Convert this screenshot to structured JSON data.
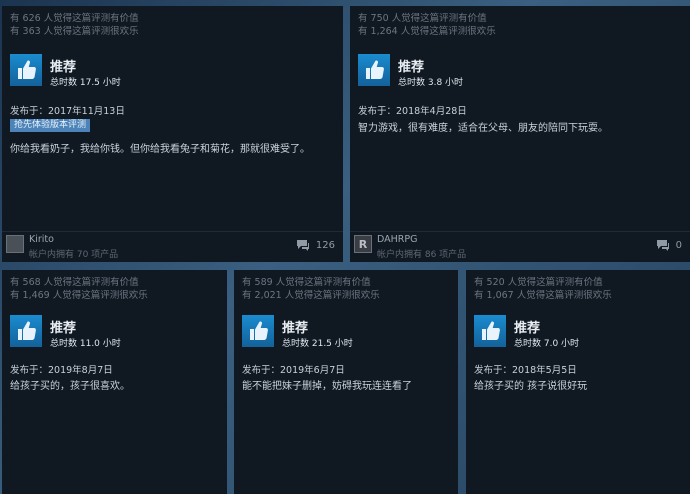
{
  "reviews": [
    {
      "helpful": "有 626 人觉得这篇评测有价值",
      "funny": "有 363 人觉得这篇评测很欢乐",
      "recommendation": "推荐",
      "hours": "总时数 17.5 小时",
      "posted": "发布于：2017年11月13日",
      "badge": "抢先体验版本评测",
      "text": "你给我看奶子，我给你钱。但你给我看兔子和菊花，那就很难受了。",
      "author": "Kirito",
      "products": "帐户内拥有 70 项产品",
      "comments": "126"
    },
    {
      "helpful": "有 750 人觉得这篇评测有价值",
      "funny": "有 1,264 人觉得这篇评测很欢乐",
      "recommendation": "推荐",
      "hours": "总时数 3.8 小时",
      "posted": "发布于：2018年4月28日",
      "text": "智力游戏，很有难度，适合在父母、朋友的陪同下玩耍。",
      "author": "DAHRPG",
      "products": "帐户内拥有 86 项产品",
      "comments": "0"
    },
    {
      "helpful": "有 568 人觉得这篇评测有价值",
      "funny": "有 1,469 人觉得这篇评测很欢乐",
      "recommendation": "推荐",
      "hours": "总时数 11.0 小时",
      "posted": "发布于：2019年8月7日",
      "text": "给孩子买的，孩子很喜欢。"
    },
    {
      "helpful": "有 589 人觉得这篇评测有价值",
      "funny": "有 2,021 人觉得这篇评测很欢乐",
      "recommendation": "推荐",
      "hours": "总时数 21.5 小时",
      "posted": "发布于：2019年6月7日",
      "text": "能不能把妹子删掉，妨碍我玩连连看了"
    },
    {
      "helpful": "有 520 人觉得这篇评测有价值",
      "funny": "有 1,067 人觉得这篇评测很欢乐",
      "recommendation": "推荐",
      "hours": "总时数 7.0 小时",
      "posted": "发布于：2018年5月5日",
      "text": "给孩子买的 孩子说很好玩"
    }
  ],
  "colors": {
    "accent": "#1a8ccf",
    "badge": "#4c84ba",
    "card": "#101822"
  }
}
